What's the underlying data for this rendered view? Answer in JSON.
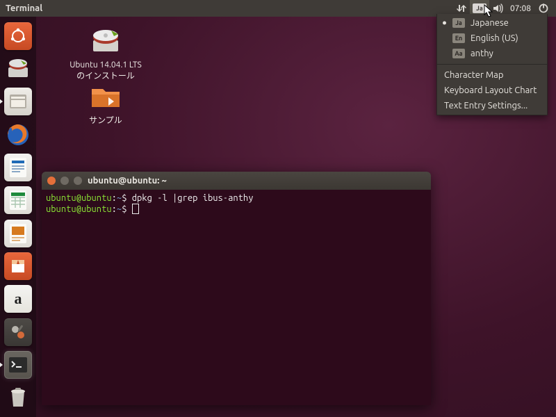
{
  "panel": {
    "app_title": "Terminal",
    "time": "07:08"
  },
  "input_method_menu": {
    "items": [
      {
        "label": "Japanese",
        "badge": "Ja",
        "selected": true
      },
      {
        "label": "English (US)",
        "badge": "En",
        "selected": false
      },
      {
        "label": "anthy",
        "badge": "Aa",
        "selected": false
      }
    ],
    "extras": [
      "Character Map",
      "Keyboard Layout Chart",
      "Text Entry Settings..."
    ]
  },
  "desktop": {
    "install_label": "Ubuntu 14.04.1 LTS\nのインストール",
    "samples_label": "サンプル"
  },
  "terminal": {
    "title": "ubuntu@ubuntu: ~",
    "prompt_user": "ubuntu@ubuntu",
    "prompt_sep": ":",
    "prompt_path": "~",
    "prompt_sign": "$",
    "command1": "dpkg -l |grep ibus-anthy",
    "command2": ""
  }
}
